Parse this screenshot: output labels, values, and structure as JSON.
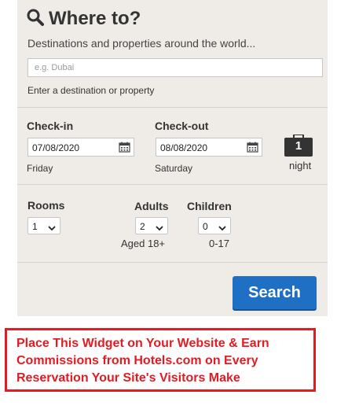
{
  "header": {
    "title": "Where to?",
    "subtitle": "Destinations and properties around the world..."
  },
  "destination": {
    "placeholder": "e.g. Dubai",
    "hint": "Enter a destination or property"
  },
  "checkin": {
    "label": "Check-in",
    "value": "07/08/2020",
    "day": "Friday"
  },
  "checkout": {
    "label": "Check-out",
    "value": "08/08/2020",
    "day": "Saturday"
  },
  "nights": {
    "count": "1",
    "label": "night"
  },
  "rooms": {
    "label": "Rooms",
    "value": "1"
  },
  "adults": {
    "label": "Adults",
    "value": "2",
    "note": "Aged 18+"
  },
  "children": {
    "label": "Children",
    "value": "0",
    "note": "0-17"
  },
  "search_button": "Search",
  "promo": {
    "lines": [
      "Place This Widget on Your Website & Earn",
      "Commissions from Hotels.com on Every",
      "Reservation Your Site's Visitors Make"
    ]
  },
  "colors": {
    "widget_bg": "#efece7",
    "button_blue": "#1f6fc4",
    "promo_red": "#e31b23"
  },
  "icons": [
    "search-icon",
    "calendar-icon",
    "suitcase-icon",
    "chevron-down-icon"
  ]
}
